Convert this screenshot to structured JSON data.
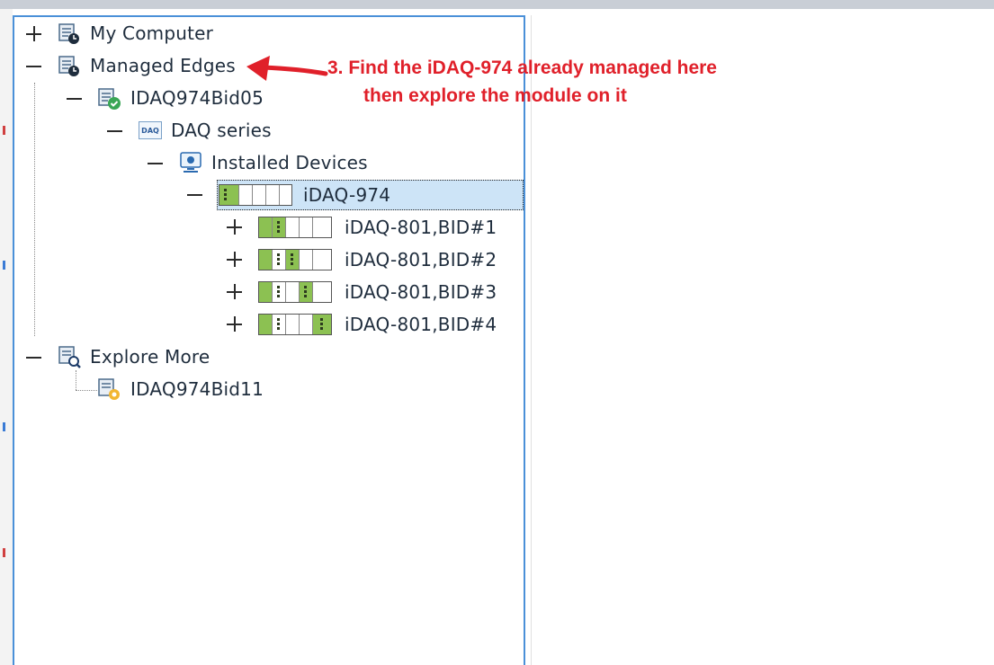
{
  "tree": {
    "my_computer": {
      "label": "My Computer",
      "toggle": "+",
      "icon": "computer-clock-icon"
    },
    "managed_edges": {
      "label": "Managed Edges",
      "toggle": "-",
      "icon": "server-clock-icon"
    },
    "edge_node": {
      "label": "IDAQ974Bid05",
      "toggle": "-",
      "icon": "server-check-icon"
    },
    "daq_series": {
      "label": "DAQ series",
      "toggle": "-",
      "icon": "daq-badge-icon",
      "badge_text": "DAQ"
    },
    "installed_devices": {
      "label": "Installed Devices",
      "toggle": "-",
      "icon": "monitor-icon"
    },
    "chassis": {
      "label": "iDAQ-974",
      "toggle": "-",
      "icon": "chassis-icon",
      "selected": true
    },
    "modules": [
      {
        "label": "iDAQ-801,BID#1",
        "toggle": "+",
        "slot": 1
      },
      {
        "label": "iDAQ-801,BID#2",
        "toggle": "+",
        "slot": 2
      },
      {
        "label": "iDAQ-801,BID#3",
        "toggle": "+",
        "slot": 3
      },
      {
        "label": "iDAQ-801,BID#4",
        "toggle": "+",
        "slot": 4
      }
    ],
    "explore_more": {
      "label": "Explore More",
      "toggle": "-",
      "icon": "server-search-icon"
    },
    "explore_node": {
      "label": "IDAQ974Bid11",
      "icon": "server-gear-icon"
    }
  },
  "annotation": {
    "line1": "3. Find the iDAQ-974 already managed here",
    "line2": "then explore the module on it",
    "color": "#e0202a"
  },
  "colors": {
    "selection": "#cde4f7",
    "panel_border": "#4a90d8",
    "module_green": "#8cc152"
  }
}
